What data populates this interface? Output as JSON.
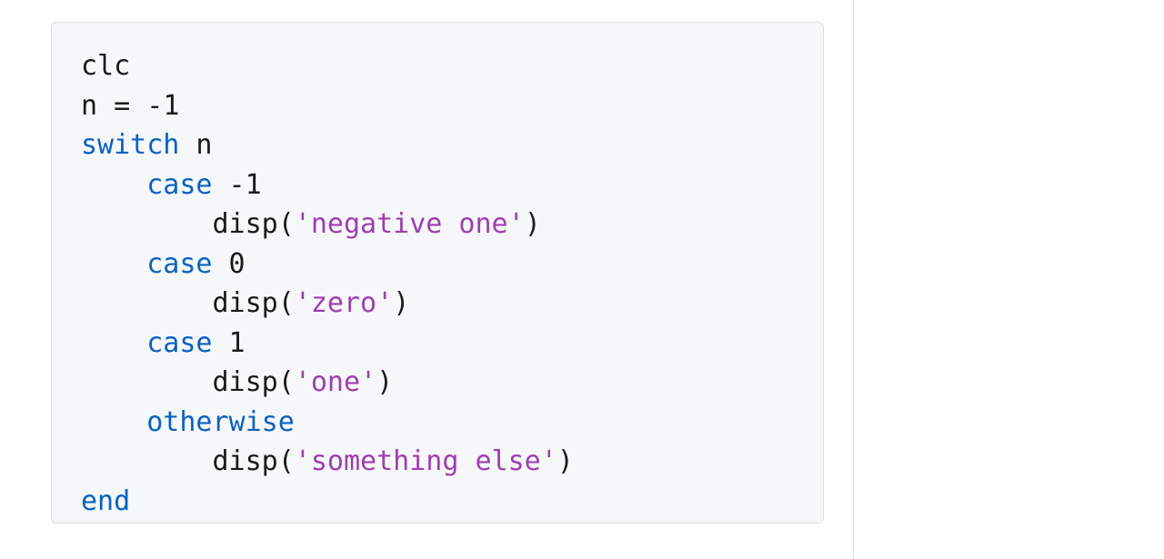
{
  "code": {
    "line1": "clc",
    "line2_a": "n = -",
    "line2_b": "1",
    "kw_switch": "switch",
    "switch_var": " n",
    "kw_case": "case",
    "case1_val": " -1",
    "case2_val": " 0",
    "case3_val": " 1",
    "disp_a": "disp(",
    "str1": "'negative one'",
    "str2": "'zero'",
    "str3": "'one'",
    "str4": "'something else'",
    "disp_b": ")",
    "kw_otherwise": "otherwise",
    "kw_end": "end",
    "sp4": "    ",
    "sp8": "        "
  }
}
